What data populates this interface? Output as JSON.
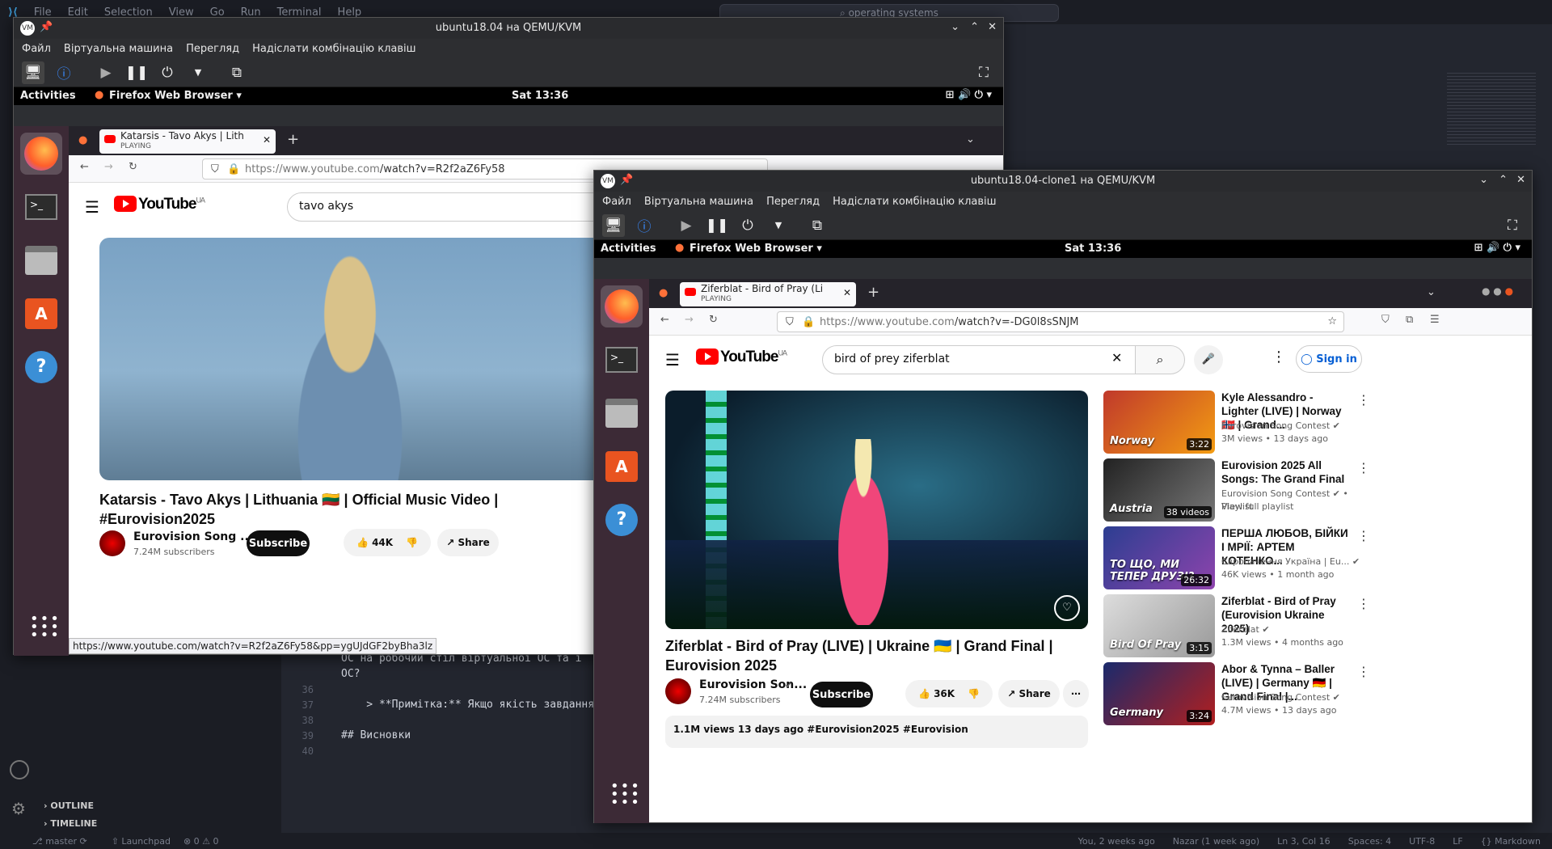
{
  "vscode": {
    "menu": [
      "File",
      "Edit",
      "Selection",
      "View",
      "Go",
      "Run",
      "Terminal",
      "Help"
    ],
    "search": "operating systems",
    "lines": [
      {
        "n": "",
        "t": "ОС на робочий стіл віртуальної ОС та і"
      },
      {
        "n": "",
        "t": "ОС?"
      },
      {
        "n": "36",
        "t": ""
      },
      {
        "n": "37",
        "t": "    > **Примітка:** Якщо якість завдання"
      },
      {
        "n": "38",
        "t": ""
      },
      {
        "n": "39",
        "t": "## Висновки"
      },
      {
        "n": "40",
        "t": ""
      }
    ],
    "outline": "OUTLINE",
    "timeline": "TIMELINE",
    "status_left": "master",
    "status_launchpad": "Launchpad",
    "status_problems": "⊗ 0 ⚠ 0",
    "status_right": [
      "You, 2 weeks ago",
      "Nazar (1 week ago)",
      "Ln 3, Col 16",
      "Spaces: 4",
      "UTF-8",
      "LF",
      "{} Markdown"
    ]
  },
  "vm1": {
    "title": "ubuntu18.04 на QEMU/KVM",
    "menu": [
      "Файл",
      "Віртуальна машина",
      "Перегляд",
      "Надіслати комбінацію клавіш"
    ],
    "activities": "Activities",
    "app": "Firefox Web Browser ▾",
    "clock": "Sat 13:36",
    "tab_title": "Katarsis - Tavo Akys | Lith",
    "tab_sub": "PLAYING",
    "url_host": "https://www.youtube.com",
    "url_path": "/watch?v=R2f2aZ6Fy58",
    "search": "tavo akys",
    "logo": "YouTube",
    "region": "UA",
    "video_title": "Katarsis - Tavo Akys | Lithuania 🇱🇹 | Official Music Video | #Eurovision2025",
    "channel": "Eurovision Song ...",
    "subs": "7.24M subscribers",
    "subscribe": "Subscribe",
    "likes": "44K",
    "share": "Share",
    "status_url": "https://www.youtube.com/watch?v=R2f2aZ6Fy58&pp=ygUJdGF2byBha3lz"
  },
  "vm2": {
    "title": "ubuntu18.04-clone1 на QEMU/KVM",
    "menu": [
      "Файл",
      "Віртуальна машина",
      "Перегляд",
      "Надіслати комбінацію клавіш"
    ],
    "activities": "Activities",
    "app": "Firefox Web Browser ▾",
    "clock": "Sat 13:36",
    "tab_title": "Ziferblat - Bird of Pray (Li",
    "tab_sub": "PLAYING",
    "url_host": "https://www.youtube.com",
    "url_path": "/watch?v=-DG0l8sSNJM",
    "search": "bird of prey ziferblat",
    "logo": "YouTube",
    "region": "UA",
    "signin": "Sign in",
    "video_title": "Ziferblat - Bird of Pray (LIVE) | Ukraine 🇺🇦 | Grand Final | Eurovision 2025",
    "channel": "Eurovision Son...",
    "subs": "7.24M subscribers",
    "subscribe": "Subscribe",
    "likes": "36K",
    "share": "Share",
    "views_line": "1.1M views  13 days ago  #Eurovision2025 #Eurovision",
    "recs": [
      {
        "title": "Kyle Alessandro - Lighter (LIVE) | Norway 🇳🇴 | Grand...",
        "channel": "Eurovision Song Contest ✔",
        "meta": "3M views • 13 days ago",
        "dur": "3:22",
        "thumb_text": "Norway",
        "c1": "#c0392b",
        "c2": "#f39c12"
      },
      {
        "title": "Eurovision 2025 All Songs: The Grand Final",
        "channel": "Eurovision Song Contest ✔ • Playlist",
        "meta": "View full playlist",
        "dur": "38 videos",
        "thumb_text": "Austria",
        "c1": "#222",
        "c2": "#777"
      },
      {
        "title": "ПЕРША ЛЮБОВ, БІЙКИ І МРІЇ: АРТЕМ КОТЕНКО...",
        "channel": "Євробачення Україна | Eu... ✔",
        "meta": "46K views • 1 month ago",
        "dur": "26:32",
        "thumb_text": "ТО ЩО, МИ ТЕПЕР ДРУЗІ?",
        "c1": "#2c3e91",
        "c2": "#8e44ad"
      },
      {
        "title": "Ziferblat - Bird of Pray (Eurovision Ukraine 2025)",
        "channel": "Ziferblat ✔",
        "meta": "1.3M views • 4 months ago",
        "dur": "3:15",
        "thumb_text": "Bird Of Pray",
        "c1": "#ddd",
        "c2": "#999"
      },
      {
        "title": "Abor & Tynna – Baller (LIVE) | Germany 🇩🇪 | Grand Final |...",
        "channel": "Eurovision Song Contest ✔",
        "meta": "4.7M views • 13 days ago",
        "dur": "3:24",
        "thumb_text": "Germany",
        "c1": "#1a2a6c",
        "c2": "#b21f1f"
      }
    ]
  }
}
